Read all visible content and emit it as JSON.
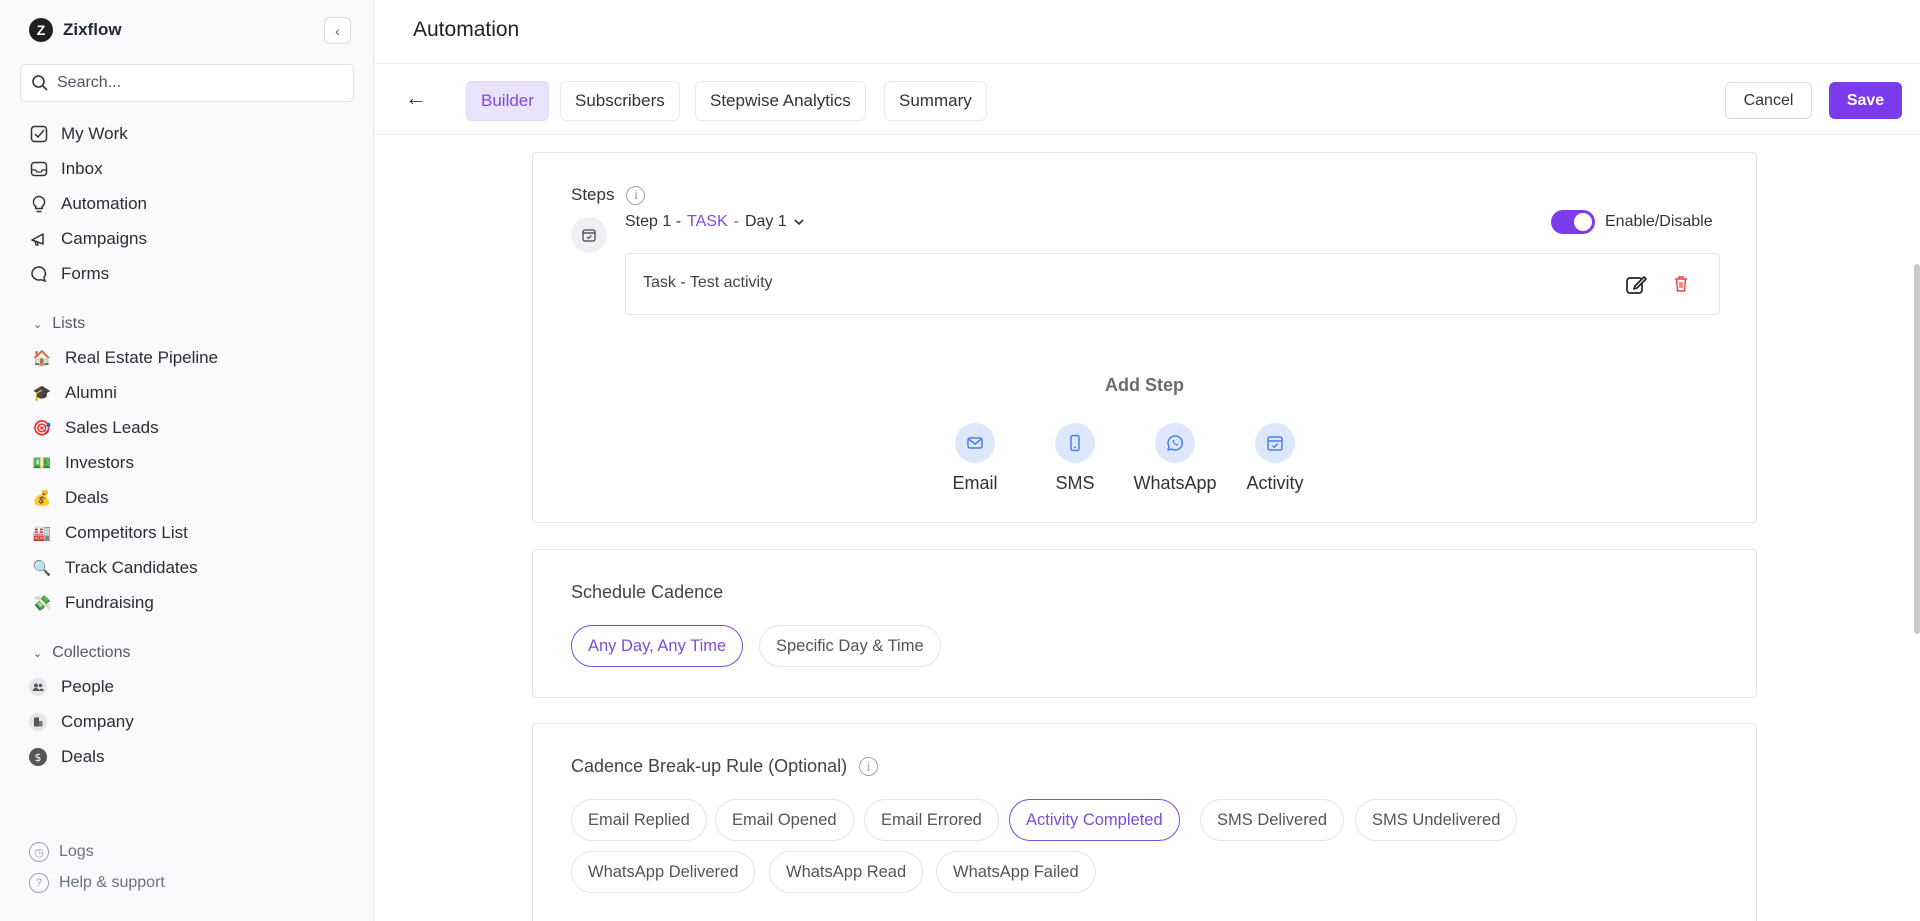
{
  "sidebar": {
    "brand": {
      "logo_letter": "Z",
      "name": "Zixflow"
    },
    "search_placeholder": "Search...",
    "nav": [
      {
        "label": "My Work",
        "icon": "checkbox-icon"
      },
      {
        "label": "Inbox",
        "icon": "inbox-icon"
      },
      {
        "label": "Automation",
        "icon": "bulb-icon"
      },
      {
        "label": "Campaigns",
        "icon": "megaphone-icon"
      },
      {
        "label": "Forms",
        "icon": "chat-bubble-icon"
      }
    ],
    "lists": {
      "heading": "Lists",
      "items": [
        {
          "label": "Real Estate Pipeline",
          "emoji": "🏠"
        },
        {
          "label": "Alumni",
          "emoji": "🎓"
        },
        {
          "label": "Sales Leads",
          "emoji": "🎯"
        },
        {
          "label": "Investors",
          "emoji": "💵"
        },
        {
          "label": "Deals",
          "emoji": "💰"
        },
        {
          "label": "Competitors List",
          "emoji": "🏭"
        },
        {
          "label": "Track Candidates",
          "emoji": "🔍"
        },
        {
          "label": "Fundraising",
          "emoji": "💸"
        }
      ]
    },
    "collections": {
      "heading": "Collections",
      "items": [
        {
          "label": "People",
          "icon": "people-icon"
        },
        {
          "label": "Company",
          "icon": "building-icon"
        },
        {
          "label": "Deals",
          "icon": "dollar-icon"
        }
      ]
    },
    "footer": {
      "logs": "Logs",
      "help": "Help & support"
    }
  },
  "header": {
    "title": "Automation"
  },
  "tabs": [
    {
      "label": "Builder",
      "active": true
    },
    {
      "label": "Subscribers",
      "active": false
    },
    {
      "label": "Stepwise Analytics",
      "active": false
    },
    {
      "label": "Summary",
      "active": false
    }
  ],
  "actions": {
    "cancel": "Cancel",
    "save": "Save"
  },
  "steps": {
    "heading": "Steps",
    "step": {
      "prefix": "Step 1 -",
      "type": "TASK",
      "separator": "-",
      "day": "Day 1"
    },
    "toggle_label": "Enable/Disable",
    "toggle_on": true,
    "task_text": "Task - Test activity",
    "add_step_label": "Add Step",
    "add_options": [
      {
        "label": "Email",
        "icon": "mail-icon"
      },
      {
        "label": "SMS",
        "icon": "phone-icon"
      },
      {
        "label": "WhatsApp",
        "icon": "whatsapp-icon"
      },
      {
        "label": "Activity",
        "icon": "calendar-icon"
      }
    ]
  },
  "schedule": {
    "heading": "Schedule Cadence",
    "options": [
      {
        "label": "Any Day, Any Time",
        "active": true
      },
      {
        "label": "Specific Day & Time",
        "active": false
      }
    ]
  },
  "breakup": {
    "heading": "Cadence Break-up Rule (Optional)",
    "options": [
      {
        "label": "Email Replied",
        "active": false
      },
      {
        "label": "Email Opened",
        "active": false
      },
      {
        "label": "Email Errored",
        "active": false
      },
      {
        "label": "Activity Completed",
        "active": true
      },
      {
        "label": "SMS Delivered",
        "active": false
      },
      {
        "label": "SMS Undelivered",
        "active": false
      },
      {
        "label": "WhatsApp Delivered",
        "active": false
      },
      {
        "label": "WhatsApp Read",
        "active": false
      },
      {
        "label": "WhatsApp Failed",
        "active": false
      }
    ]
  },
  "colors": {
    "accent": "#7c3aed",
    "accent_text": "#7c4ddb",
    "tab_active_bg": "#e9e3fb",
    "delete": "#ef4444"
  }
}
